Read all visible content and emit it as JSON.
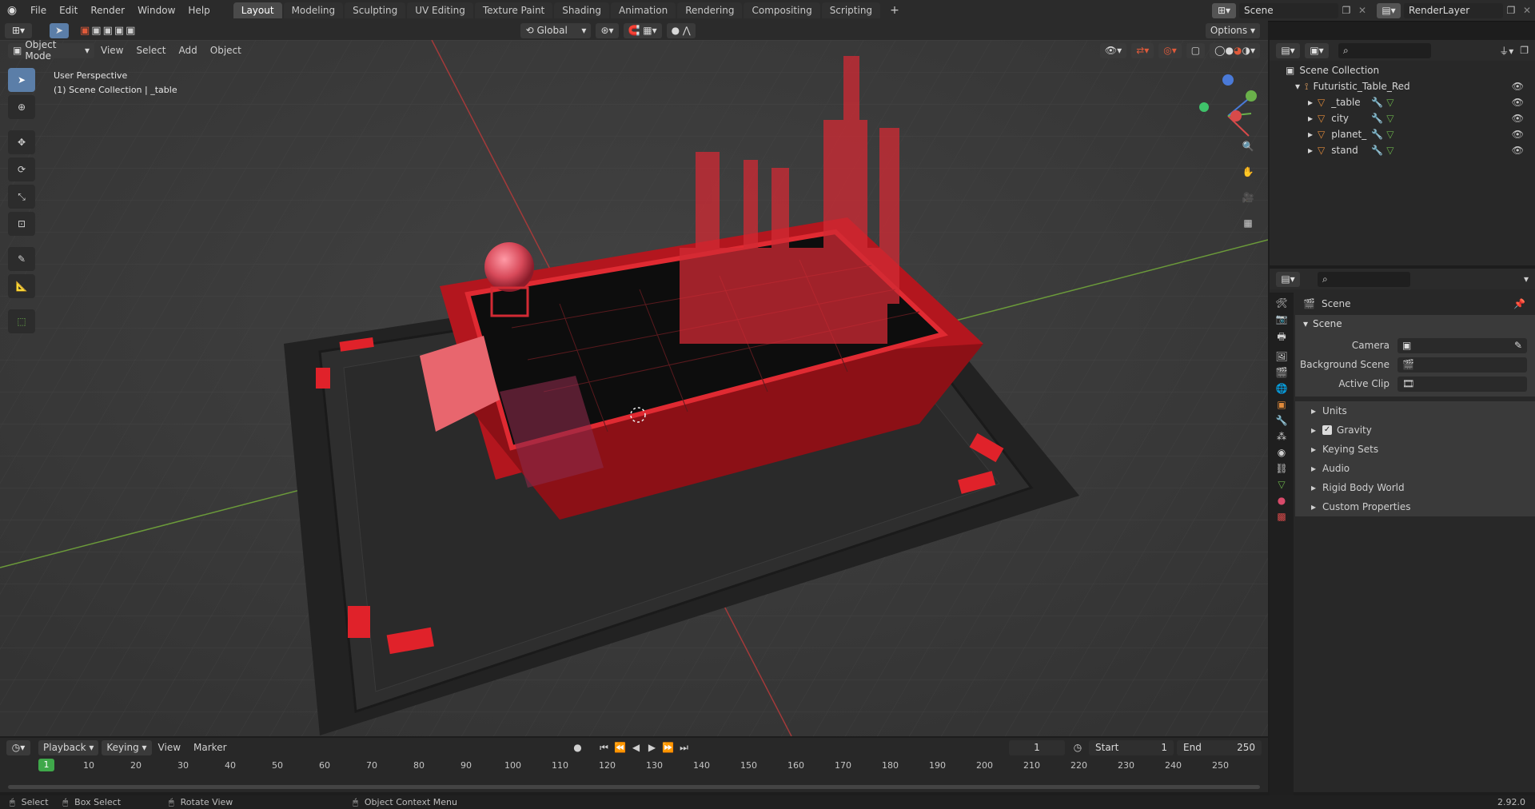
{
  "menu": [
    "File",
    "Edit",
    "Render",
    "Window",
    "Help"
  ],
  "workspaces": [
    "Layout",
    "Modeling",
    "Sculpting",
    "UV Editing",
    "Texture Paint",
    "Shading",
    "Animation",
    "Rendering",
    "Compositing",
    "Scripting"
  ],
  "active_workspace": "Layout",
  "scene_field": "Scene",
  "renderlayer_field": "RenderLayer",
  "toolbar2": {
    "orientation": "Global",
    "options": "Options"
  },
  "viewport_header": {
    "mode": "Object Mode",
    "menus": [
      "View",
      "Select",
      "Add",
      "Object"
    ]
  },
  "overlay_text": {
    "perspective": "User Perspective",
    "collection": "(1) Scene Collection | _table"
  },
  "outliner": {
    "root": "Scene Collection",
    "collection": "Futuristic_Table_Red",
    "objects": [
      "_table",
      "city",
      "planet_",
      "stand"
    ]
  },
  "properties": {
    "header": "Scene",
    "panel": "Scene",
    "fields": [
      {
        "label": "Camera",
        "value": ""
      },
      {
        "label": "Background Scene",
        "value": ""
      },
      {
        "label": "Active Clip",
        "value": ""
      }
    ],
    "subpanels": [
      "Units",
      "Gravity",
      "Keying Sets",
      "Audio",
      "Rigid Body World",
      "Custom Properties"
    ],
    "gravity_checked": true
  },
  "timeline": {
    "menus": [
      "Playback",
      "Keying",
      "View",
      "Marker"
    ],
    "current_frame": "1",
    "start_label": "Start",
    "start": "1",
    "end_label": "End",
    "end": "250",
    "ticks": [
      "10",
      "20",
      "30",
      "40",
      "50",
      "60",
      "70",
      "80",
      "90",
      "100",
      "110",
      "120",
      "130",
      "140",
      "150",
      "160",
      "170",
      "180",
      "190",
      "200",
      "210",
      "220",
      "230",
      "240",
      "250"
    ],
    "playhead": "1"
  },
  "statusbar": {
    "select": "Select",
    "box_select": "Box Select",
    "rotate": "Rotate View",
    "context": "Object Context Menu",
    "version": "2.92.0"
  },
  "colors": {
    "accent": "#5b7ea8",
    "table_red": "#d81f26",
    "header_bg": "#2b2b2b",
    "panel_bg": "#282828"
  }
}
